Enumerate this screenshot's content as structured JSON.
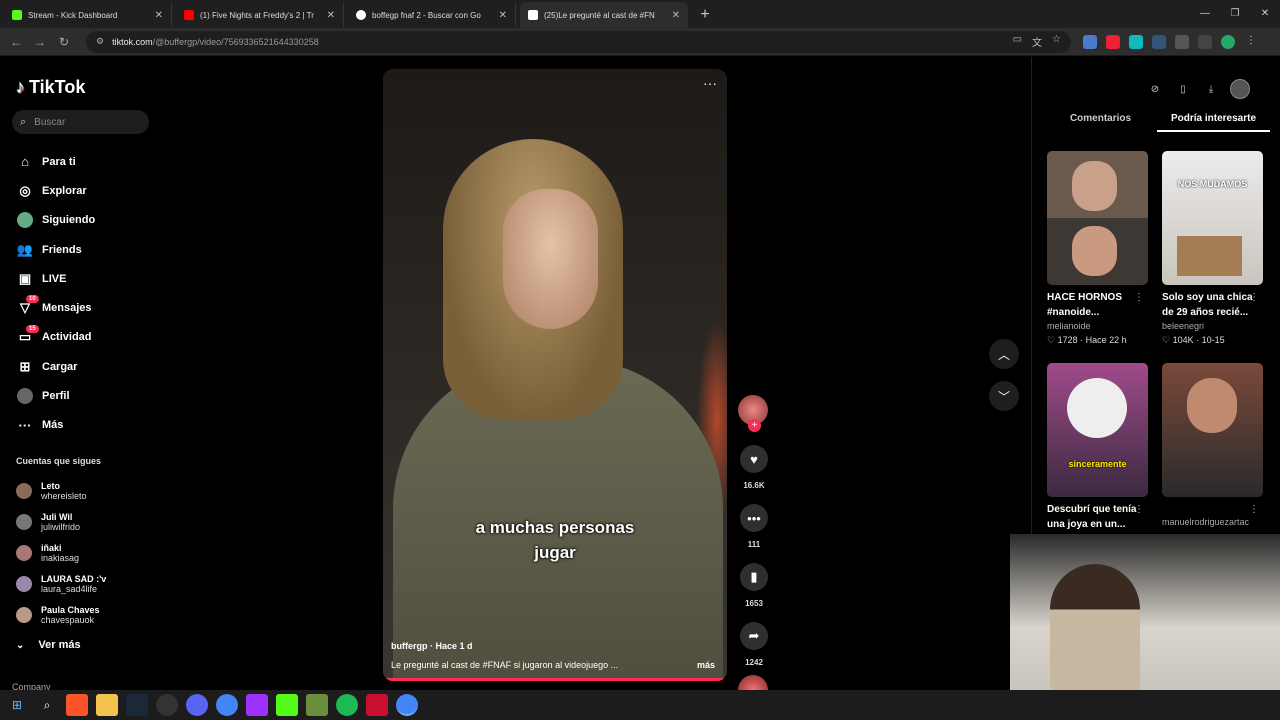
{
  "browser": {
    "tabs": [
      {
        "title": "Stream - Kick Dashboard",
        "favicon_color": "#53fc18"
      },
      {
        "title": "(1) Five Nights at Freddy's 2 | Tr",
        "favicon_color": "#ff0000"
      },
      {
        "title": "boffegp fnaf 2 - Buscar con Go",
        "favicon_color": "#ffffff"
      },
      {
        "title": "(25)Le pregunté al cast de #FN",
        "favicon_color": "#ffffff",
        "active": true
      }
    ],
    "url_host": "tiktok.com",
    "url_path": "/@buffergp/video/7569336521644330258"
  },
  "sidebar": {
    "brand": "TikTok",
    "search_placeholder": "Buscar",
    "nav": [
      {
        "label": "Para ti",
        "icon": "home-icon"
      },
      {
        "label": "Explorar",
        "icon": "compass-icon"
      },
      {
        "label": "Siguiendo",
        "icon": "following-avatar-icon"
      },
      {
        "label": "Friends",
        "icon": "friends-icon"
      },
      {
        "label": "LIVE",
        "icon": "live-icon"
      },
      {
        "label": "Mensajes",
        "icon": "message-icon",
        "badge": "10"
      },
      {
        "label": "Actividad",
        "icon": "activity-icon",
        "badge": "15"
      },
      {
        "label": "Cargar",
        "icon": "upload-icon"
      },
      {
        "label": "Perfil",
        "icon": "profile-icon"
      },
      {
        "label": "Más",
        "icon": "more-icon"
      }
    ],
    "following_heading": "Cuentas que sigues",
    "following": [
      {
        "name": "Leto",
        "handle": "whereisleto"
      },
      {
        "name": "Juli Wil",
        "handle": "juliwilfrido"
      },
      {
        "name": "iñaki",
        "handle": "inakiasag"
      },
      {
        "name": "LAURA SAD :'v",
        "handle": "laura_sad4life"
      },
      {
        "name": "Paula Chaves",
        "handle": "chavespauok"
      }
    ],
    "see_more": "Ver más",
    "company": "Company"
  },
  "video": {
    "caption_line1": "a muchas personas",
    "caption_line2": "jugar",
    "author_line": "buffergp · Hace 1 d",
    "description": "Le pregunté al cast de #FNAF  si jugaron al videojuego ...",
    "more": "más"
  },
  "actions": {
    "likes": "16.6K",
    "comments": "111",
    "saves": "1653",
    "shares": "1242"
  },
  "right_panel": {
    "tabs": [
      "Comentarios",
      "Podría interesarte"
    ],
    "active_tab": 1,
    "cards": [
      {
        "title": "HACE HORNOS #nanoide...",
        "author": "melianoide",
        "stats": "1728 · Hace 22 h"
      },
      {
        "title": "Solo soy una chica de 29 años recié...",
        "author": "beleenegri",
        "stats": "104K · 10-15",
        "overlay": "NOS MUDAMOS"
      },
      {
        "title": "Descubrí que tenía una joya en un...",
        "author": "",
        "stats": "",
        "overlay": "sinceramente"
      },
      {
        "title": "",
        "author": "manuelrodriguezartac",
        "stats": ""
      }
    ]
  }
}
